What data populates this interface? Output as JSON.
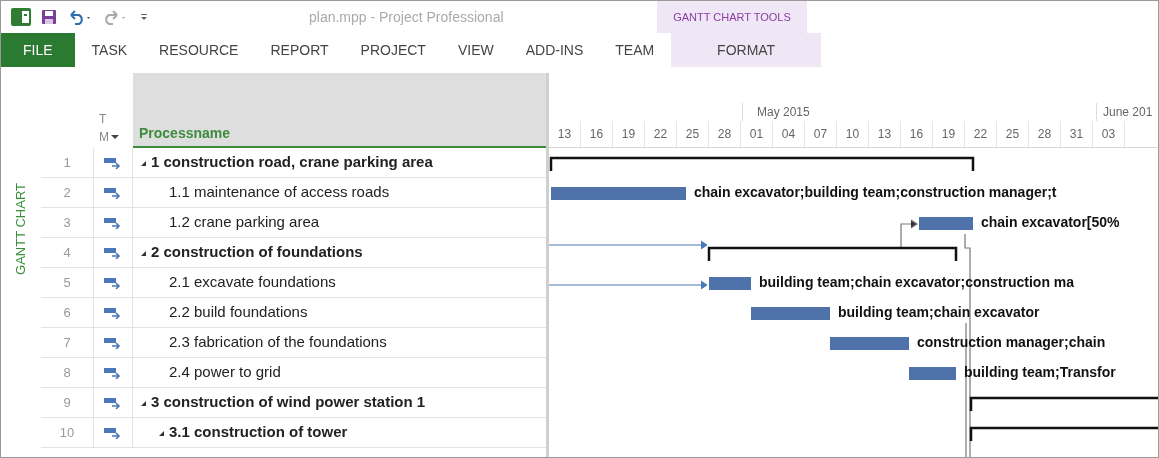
{
  "window": {
    "title": "plan.mpp - Project Professional"
  },
  "contextual_group": {
    "label": "GANTT CHART TOOLS"
  },
  "ribbon_tabs": [
    {
      "label": "FILE",
      "kind": "file"
    },
    {
      "label": "TASK",
      "kind": "plain"
    },
    {
      "label": "RESOURCE",
      "kind": "plain"
    },
    {
      "label": "REPORT",
      "kind": "plain"
    },
    {
      "label": "PROJECT",
      "kind": "plain"
    },
    {
      "label": "VIEW",
      "kind": "plain"
    },
    {
      "label": "ADD-INS",
      "kind": "plain"
    },
    {
      "label": "TEAM",
      "kind": "plain"
    },
    {
      "label": "FORMAT",
      "kind": "contextual"
    }
  ],
  "view_label": "GANTT CHART",
  "table": {
    "columns": [
      {
        "label": "T"
      },
      {
        "label": "M"
      },
      {
        "label": "Processname"
      }
    ],
    "rows": [
      {
        "number": "1",
        "name": "1 construction road, crane parking area",
        "summary": true,
        "children": [
          {
            "number": "2",
            "name": "1.1 maintenance of access roads",
            "summary": false,
            "bar_label": "chain excavator;building team;construction manager;t"
          },
          {
            "number": "3",
            "name": "1.2 crane parking area",
            "summary": false,
            "bar_label": "chain excavator[50%"
          }
        ]
      },
      {
        "number": "4",
        "name": "2 construction of foundations",
        "summary": true,
        "children": [
          {
            "number": "5",
            "name": "2.1 excavate foundations",
            "summary": false,
            "bar_label": "building team;chain excavator;construction ma"
          },
          {
            "number": "6",
            "name": "2.2 build foundations",
            "summary": false,
            "bar_label": "building team;chain excavator"
          },
          {
            "number": "7",
            "name": "2.3 fabrication of the foundations",
            "summary": false,
            "bar_label": "construction manager;chain"
          },
          {
            "number": "8",
            "name": "2.4 power to grid",
            "summary": false,
            "bar_label": "building team;Transfor"
          }
        ]
      },
      {
        "number": "9",
        "name": "3 construction of wind power station 1",
        "summary": true,
        "children": [
          {
            "number": "10",
            "name": "3.1 construction of tower",
            "summary": true
          }
        ]
      }
    ]
  },
  "timescale": {
    "months": [
      "May 2015",
      "June 201"
    ],
    "days": [
      "13",
      "16",
      "19",
      "22",
      "25",
      "28",
      "01",
      "04",
      "07",
      "10",
      "13",
      "16",
      "19",
      "22",
      "25",
      "28",
      "31",
      "03"
    ]
  }
}
